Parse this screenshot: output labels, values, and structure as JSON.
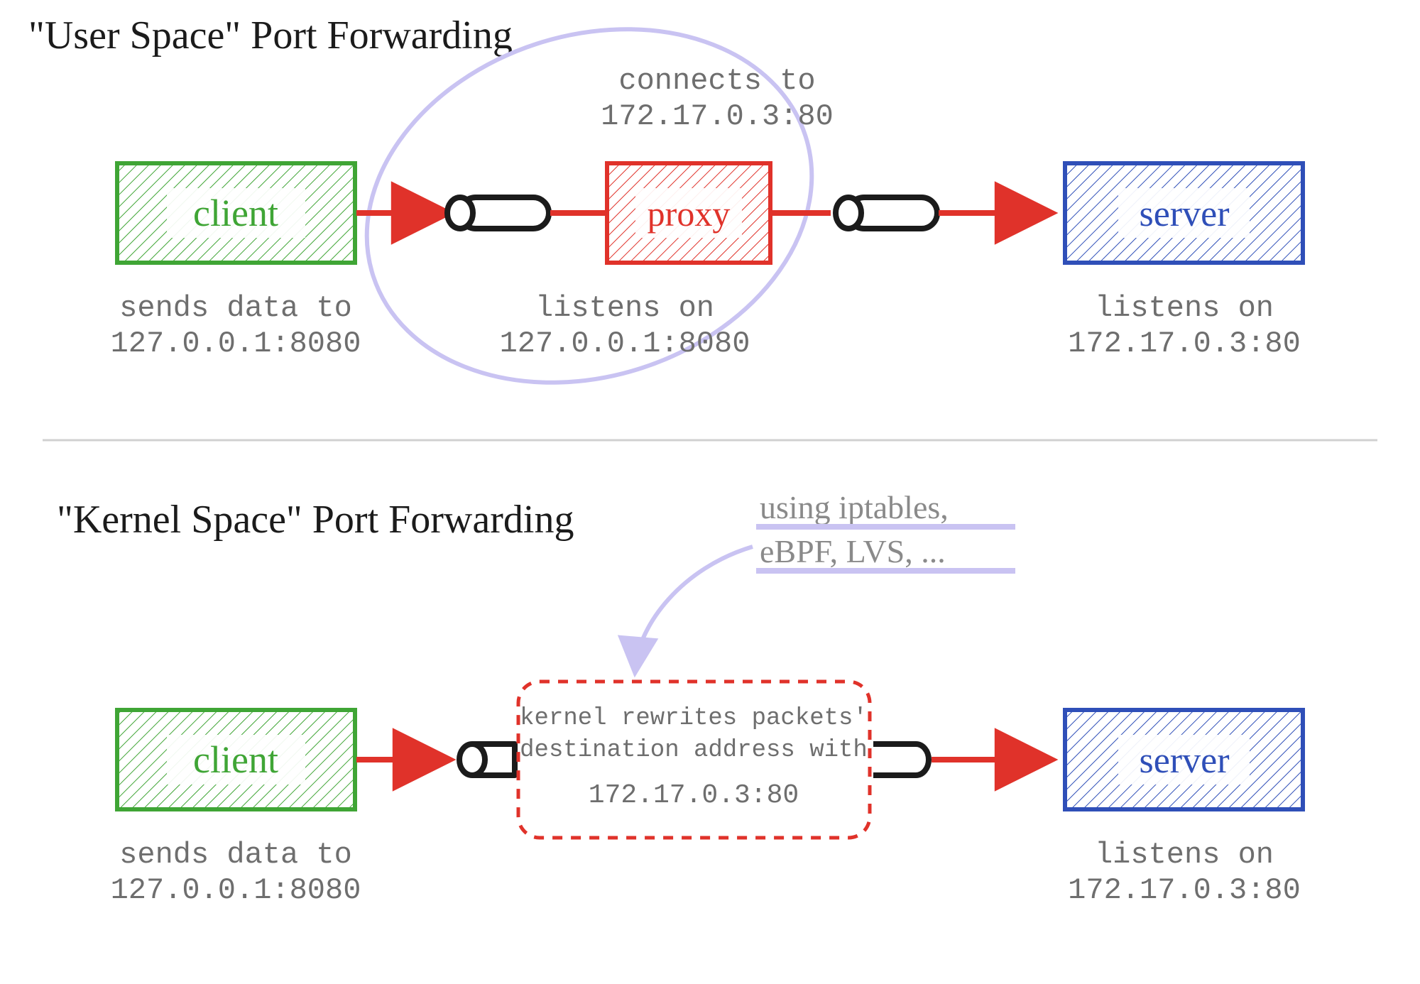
{
  "colors": {
    "green": "#3FA535",
    "red": "#E0322A",
    "blue": "#2F4FB8",
    "ink": "#1B1B1B",
    "grey": "#6E6E6E",
    "greyLight": "#9A9A9A",
    "lavender": "#C9C3F2"
  },
  "top": {
    "title": "\"User Space\" Port Forwarding",
    "client": {
      "label": "client",
      "sub1": "sends data to",
      "sub2": "127.0.0.1:8080"
    },
    "proxy": {
      "label": "proxy",
      "topNote1": "connects to",
      "topNote2": "172.17.0.3:80",
      "sub1": "listens on",
      "sub2": "127.0.0.1:8080"
    },
    "server": {
      "label": "server",
      "sub1": "listens on",
      "sub2": "172.17.0.3:80"
    }
  },
  "bottom": {
    "title": "\"Kernel Space\" Port Forwarding",
    "client": {
      "label": "client",
      "sub1": "sends data to",
      "sub2": "127.0.0.1:8080"
    },
    "kernel": {
      "line1": "kernel rewrites packets'",
      "line2": "destination address with",
      "line3": "172.17.0.3:80"
    },
    "hint": {
      "line1": "using iptables,",
      "line2": "eBPF, LVS, ..."
    },
    "server": {
      "label": "server",
      "sub1": "listens on",
      "sub2": "172.17.0.3:80"
    }
  }
}
